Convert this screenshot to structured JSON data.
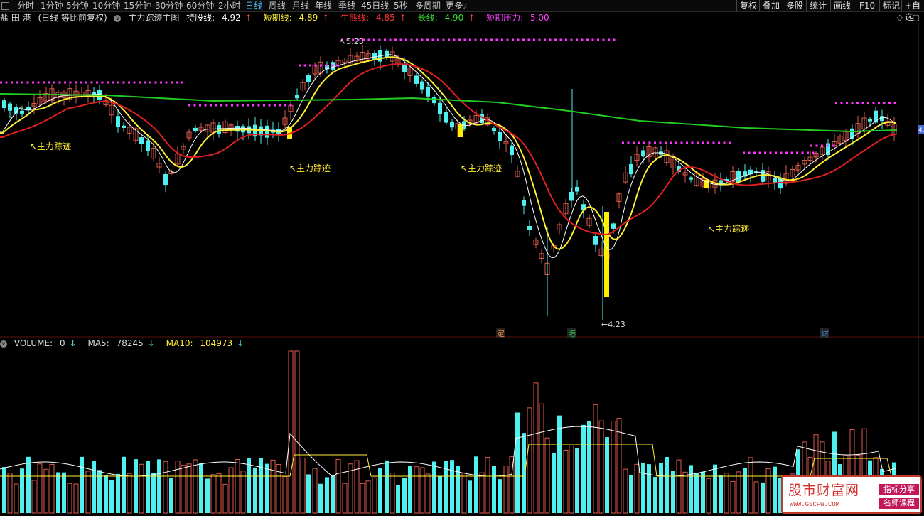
{
  "toolbar": {
    "periods": [
      "分时",
      "1分钟",
      "5分钟",
      "10分钟",
      "15分钟",
      "30分钟",
      "60分钟",
      "2小时",
      "日线",
      "周线",
      "月线",
      "年线",
      "季线",
      "45日线",
      "5秒",
      "多周期",
      "更多"
    ],
    "active_period": "日线",
    "right_buttons": [
      "复权",
      "叠加",
      "多股",
      "统计",
      "画线",
      "F10",
      "标记",
      "+自选"
    ]
  },
  "info": {
    "stock_name": "盐 田 港",
    "mode": "(日线 等比前复权)",
    "indicator": "主力踪迹主图",
    "hold_label": "持股线:",
    "hold_value": "4.92",
    "hold_arrow": "↑",
    "short_label": "短期线:",
    "short_value": "4.89",
    "short_arrow": "↑",
    "bull_label": "牛熊线:",
    "bull_value": "4.85",
    "bull_arrow": "↑",
    "long_label": "长线:",
    "long_value": "4.90",
    "long_arrow": "↑",
    "pressure_label": "短期压力:",
    "pressure_value": "5.00"
  },
  "colors": {
    "up": "#e05a4a",
    "down": "#4ff0f0",
    "hold_line": "#ffffff",
    "short_line": "#ffee33",
    "bull_line": "#e02020",
    "long_line": "#22cc22",
    "pressure_dots": "#ff33ff",
    "label_text": "#ffee33"
  },
  "annotations": {
    "trace_label": "主力踪迹",
    "high_price": "5.23",
    "low_price": "4.23",
    "price_tag": "4.",
    "event_markers": [
      "定",
      "港",
      "财"
    ]
  },
  "volume": {
    "label": "VOLUME:",
    "value": "0",
    "value_arrow": "↓",
    "ma5_label": "MA5:",
    "ma5_value": "78245",
    "ma5_arrow": "↓",
    "ma10_label": "MA10:",
    "ma10_value": "104973",
    "ma10_arrow": "↓"
  },
  "watermark": {
    "title": "股市财富网",
    "url": "WWW.GSCFW.COM",
    "badge1": "指标分享",
    "badge2": "名师课程"
  }
}
